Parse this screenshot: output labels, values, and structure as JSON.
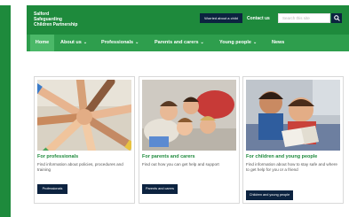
{
  "header": {
    "logo_lines": [
      "Salford",
      "Safeguarding",
      "Children Partnership"
    ],
    "worried_button": "Worried about a child",
    "contact_link": "Contact us",
    "search_placeholder": "Search this site"
  },
  "nav": {
    "items": [
      {
        "label": "Home",
        "dropdown": false,
        "active": true
      },
      {
        "label": "About us",
        "dropdown": true,
        "active": false
      },
      {
        "label": "Professionals",
        "dropdown": true,
        "active": false
      },
      {
        "label": "Parents and carers",
        "dropdown": true,
        "active": false
      },
      {
        "label": "Young people",
        "dropdown": true,
        "active": false
      },
      {
        "label": "News",
        "dropdown": false,
        "active": false
      }
    ]
  },
  "cards": [
    {
      "title": "For professionals",
      "description": "Find information about policies, procedures and training",
      "button": "Professionals",
      "image_icon": "hands-together-photo"
    },
    {
      "title": "For parents and carers",
      "description": "Find out how you can get help and support",
      "button": "Parents and carers",
      "image_icon": "family-lying-on-floor-photo"
    },
    {
      "title": "For children and young people",
      "description": "Find information about how to stay safe and where to get help for you or a friend",
      "button": "Children and young people",
      "image_icon": "children-reading-photo"
    }
  ],
  "colors": {
    "brand_green": "#1e8a3c",
    "nav_green": "#2e9e4d",
    "active_green": "#4bb868",
    "navy": "#0c2340"
  }
}
